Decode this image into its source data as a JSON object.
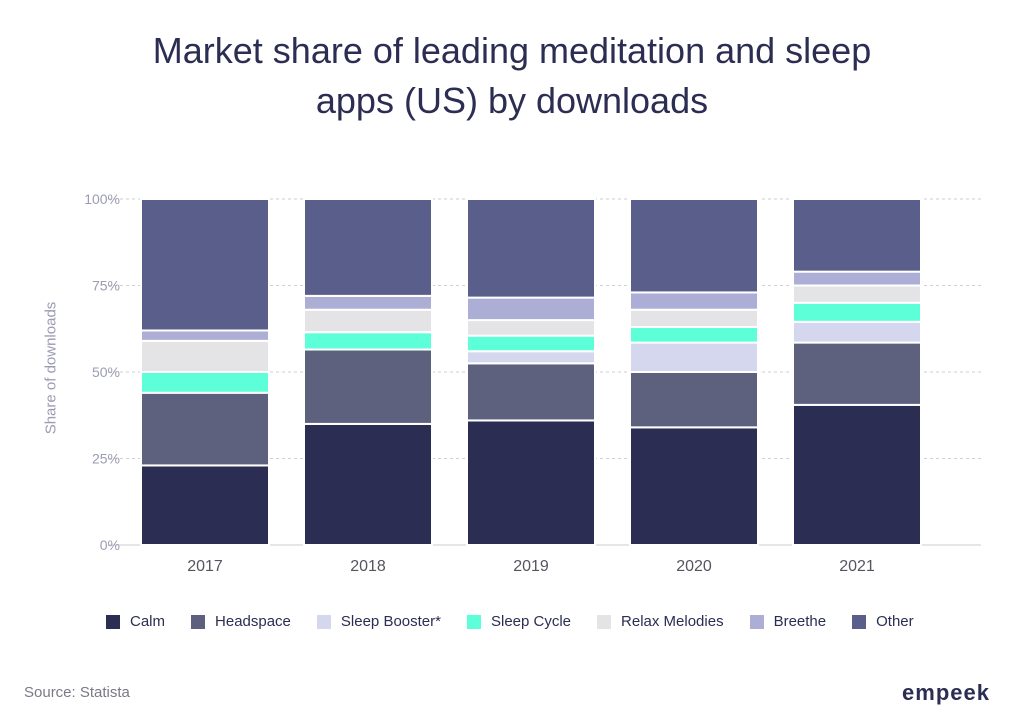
{
  "chart_data": {
    "type": "bar",
    "stacked": true,
    "title": "Market share of leading meditation and sleep apps (US) by downloads",
    "title_lines": [
      "Market share of leading meditation and sleep",
      "apps (US) by downloads"
    ],
    "xlabel": "",
    "ylabel": "Share of downloads",
    "ylim": [
      0,
      100
    ],
    "yticks": [
      0,
      25,
      50,
      75,
      100
    ],
    "ytick_labels": [
      "0%",
      "25%",
      "50%",
      "75%",
      "100%"
    ],
    "grid": true,
    "legend_position": "bottom",
    "categories": [
      "2017",
      "2018",
      "2019",
      "2020",
      "2021"
    ],
    "series": [
      {
        "name": "Calm",
        "color": "#2b2d52",
        "values": [
          23,
          35,
          36,
          34,
          40.5
        ]
      },
      {
        "name": "Headspace",
        "color": "#5e617d",
        "values": [
          21,
          21.5,
          16.5,
          16,
          18
        ]
      },
      {
        "name": "Sleep Booster*",
        "color": "#d5d7ee",
        "values": [
          0,
          0,
          3.5,
          8.5,
          6
        ]
      },
      {
        "name": "Sleep Cycle",
        "color": "#5dffd8",
        "values": [
          6,
          5,
          4.5,
          4.5,
          5.5
        ]
      },
      {
        "name": "Relax Melodies",
        "color": "#e4e4e6",
        "values": [
          9,
          6.5,
          4.5,
          5,
          5
        ]
      },
      {
        "name": "Breethe",
        "color": "#adaed6",
        "values": [
          3,
          4,
          6.5,
          5,
          4
        ]
      },
      {
        "name": "Other",
        "color": "#5a5e8a",
        "values": [
          38,
          28,
          28.5,
          27,
          21
        ]
      }
    ]
  },
  "footer": {
    "source": "Source: Statista",
    "logo": "empeek"
  }
}
